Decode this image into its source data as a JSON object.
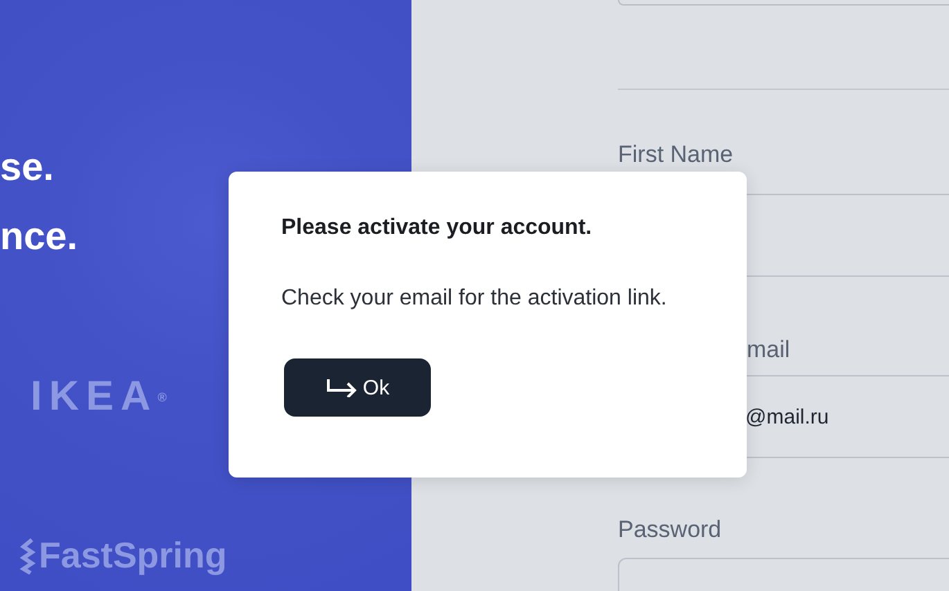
{
  "hero": {
    "lines": [
      "se.",
      "nce."
    ],
    "logos": [
      {
        "kind": "ikea",
        "text": "IKEA$^{®}$"
      },
      {
        "kind": "fastspring",
        "text": "FastSpring"
      }
    ]
  },
  "form": {
    "fields": [
      {
        "label": "First Name"
      },
      {
        "label": "mail",
        "value": "@mail.ru"
      },
      {
        "label": "Password"
      }
    ]
  },
  "dialog": {
    "title": "Please activate your account.",
    "message": "Check your email for the activation link.",
    "button": "Ok"
  }
}
